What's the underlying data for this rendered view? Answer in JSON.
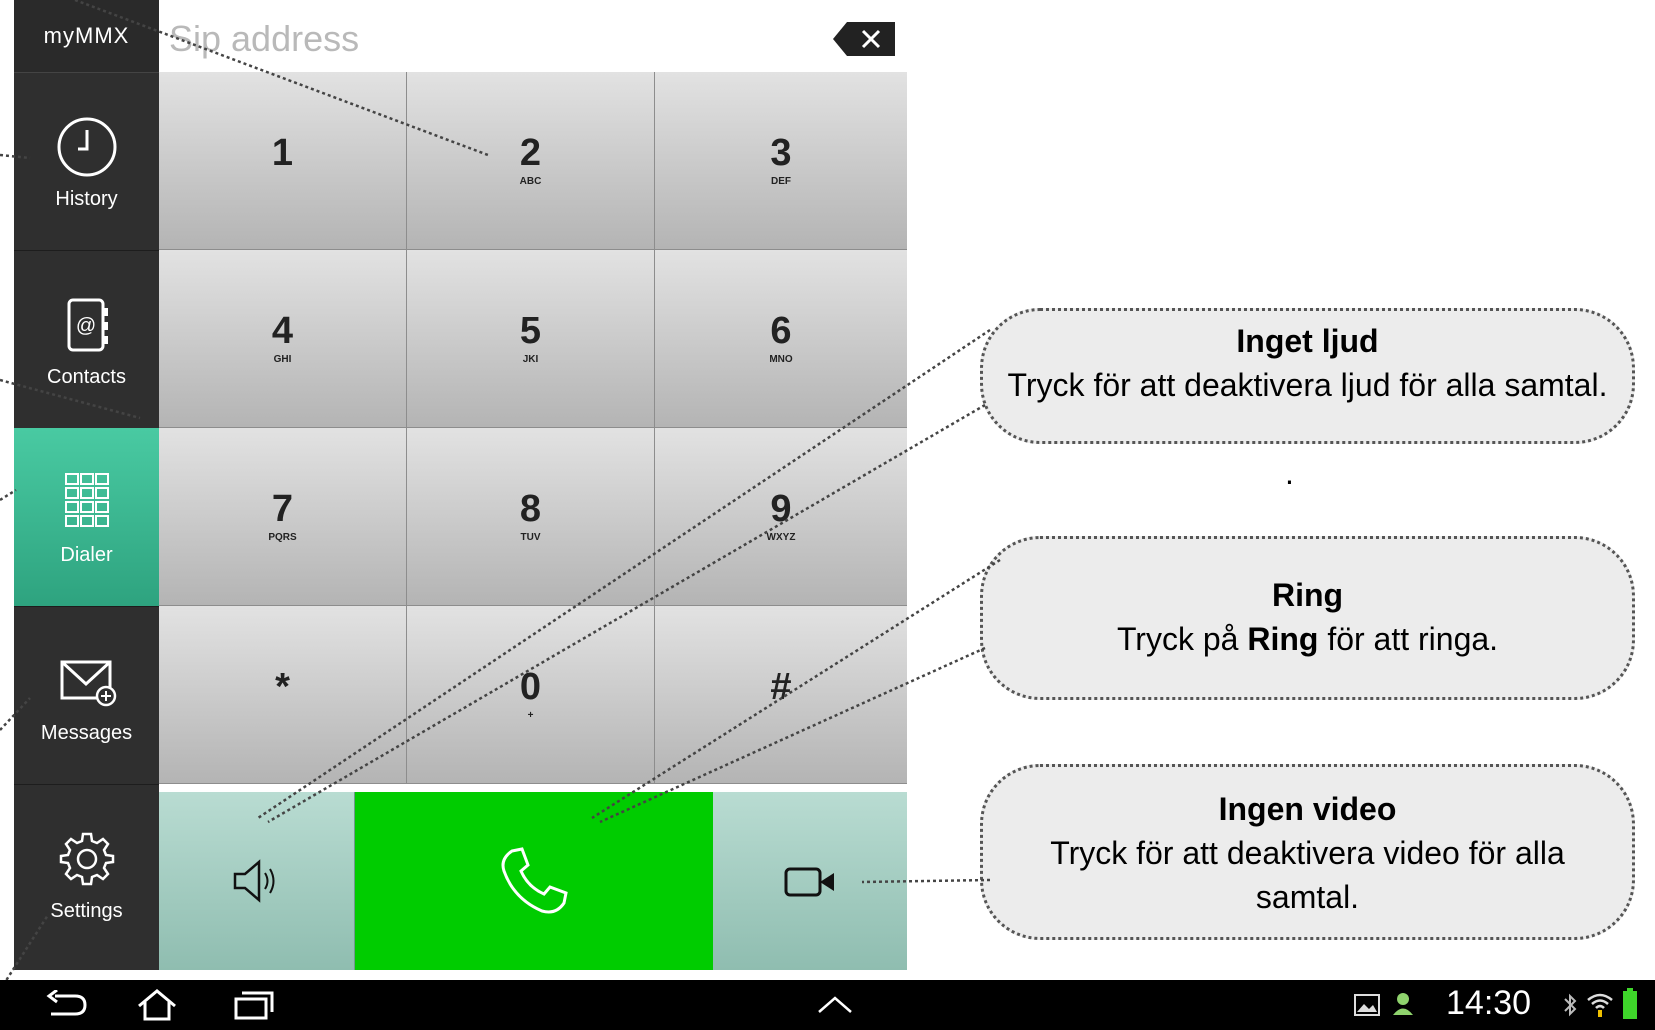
{
  "app": {
    "logo": "myMMX"
  },
  "sidebar": {
    "items": [
      {
        "label": "History",
        "icon": "clock-icon"
      },
      {
        "label": "Contacts",
        "icon": "address-book-icon"
      },
      {
        "label": "Dialer",
        "icon": "dialpad-icon",
        "active": true
      },
      {
        "label": "Messages",
        "icon": "envelope-icon"
      },
      {
        "label": "Settings",
        "icon": "gear-icon"
      }
    ]
  },
  "sip": {
    "placeholder": "Sip address",
    "backspace_icon": "backspace-icon"
  },
  "keypad": {
    "keys": [
      {
        "digit": "1",
        "letters": ""
      },
      {
        "digit": "2",
        "letters": "ABC"
      },
      {
        "digit": "3",
        "letters": "DEF"
      },
      {
        "digit": "4",
        "letters": "GHI"
      },
      {
        "digit": "5",
        "letters": "JKI"
      },
      {
        "digit": "6",
        "letters": "MNO"
      },
      {
        "digit": "7",
        "letters": "PQRS"
      },
      {
        "digit": "8",
        "letters": "TUV"
      },
      {
        "digit": "9",
        "letters": "WXYZ"
      },
      {
        "digit": "*",
        "letters": ""
      },
      {
        "digit": "0",
        "letters": "+"
      },
      {
        "digit": "#",
        "letters": ""
      }
    ]
  },
  "actions": {
    "mute_icon": "speaker-icon",
    "call_icon": "phone-icon",
    "video_icon": "video-camera-icon"
  },
  "callouts": {
    "mute": {
      "title": "Inget ljud",
      "text": "Tryck för att deaktivera ljud  för alla samtal."
    },
    "ring": {
      "title": "Ring",
      "text_before": "Tryck på ",
      "text_bold": "Ring",
      "text_after": " för att ringa."
    },
    "video": {
      "title": "Ingen video",
      "text": "Tryck för att deaktivera video för alla samtal."
    },
    "stray_dot": "."
  },
  "statusbar": {
    "time": "14:30"
  },
  "colors": {
    "accent": "#3ec49b",
    "call": "#00cc00",
    "sidebar": "#2f2f2f"
  }
}
